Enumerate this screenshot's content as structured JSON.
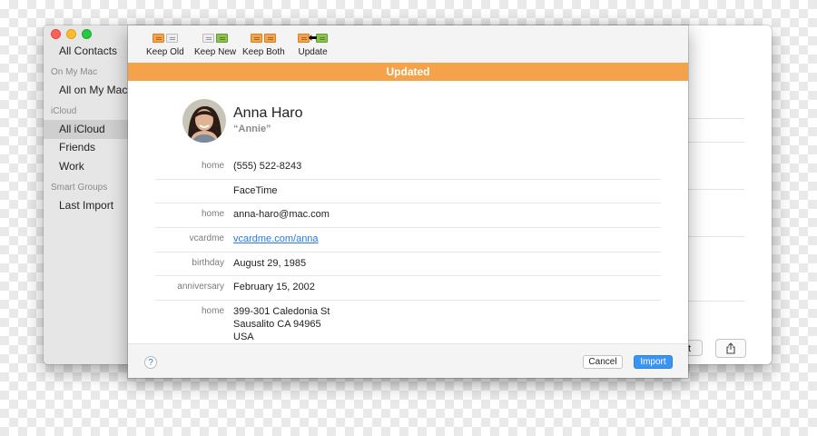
{
  "window": {
    "sidebar": {
      "all_contacts": "All Contacts",
      "groups": [
        {
          "header": "On My Mac",
          "items": [
            "All on My Mac"
          ]
        },
        {
          "header": "iCloud",
          "items": [
            "All iCloud",
            "Friends",
            "Work"
          ]
        },
        {
          "header": "Smart Groups",
          "items": [
            "Last Import"
          ]
        }
      ],
      "selected": "All iCloud"
    },
    "edit_button_partial": "t"
  },
  "sheet": {
    "toolbar": [
      {
        "label": "Keep Old",
        "icon": "keep-old-icon"
      },
      {
        "label": "Keep New",
        "icon": "keep-new-icon"
      },
      {
        "label": "Keep Both",
        "icon": "keep-both-icon"
      },
      {
        "label": "Update",
        "icon": "update-icon"
      }
    ],
    "banner": "Updated",
    "banner_color": "#f5a34a",
    "contact": {
      "name": "Anna Haro",
      "nickname": "“Annie”",
      "fields": [
        {
          "label": "home",
          "value": "(555) 522-8243"
        },
        {
          "label": "",
          "value": "FaceTime"
        },
        {
          "label": "home",
          "value": "anna-haro@mac.com"
        },
        {
          "label": "vcardme",
          "value": "vcardme.com/anna",
          "link": true
        },
        {
          "label": "birthday",
          "value": "August 29, 1985"
        },
        {
          "label": "anniversary",
          "value": "February 15, 2002"
        },
        {
          "label": "home",
          "value": [
            "399-301 Caledonia St",
            "Sausalito CA 94965",
            "USA"
          ]
        }
      ]
    },
    "footer": {
      "help": "?",
      "cancel": "Cancel",
      "import": "Import"
    },
    "accent_color": "#3a94f2"
  }
}
